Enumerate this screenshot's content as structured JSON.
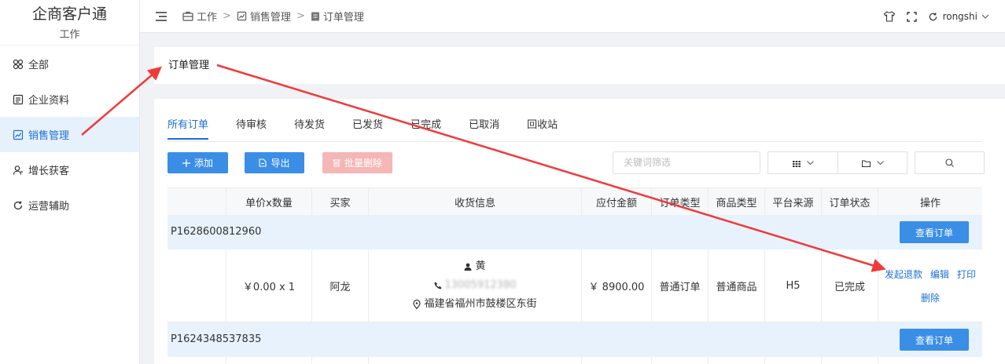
{
  "sidebar": {
    "brand_title": "企商客户通",
    "brand_sub": "工作",
    "items": [
      {
        "label": "全部",
        "icon": "apps-icon"
      },
      {
        "label": "企业资料",
        "icon": "document-icon"
      },
      {
        "label": "销售管理",
        "icon": "sales-icon"
      },
      {
        "label": "增长获客",
        "icon": "user-growth-icon"
      },
      {
        "label": "运营辅助",
        "icon": "refresh-icon"
      }
    ],
    "active_index": 2
  },
  "header": {
    "breadcrumb": [
      "工作",
      "销售管理",
      "订单管理"
    ],
    "separator": ">",
    "username": "rongshi"
  },
  "page_title": "订单管理",
  "tabs": [
    "所有订单",
    "待审核",
    "待发货",
    "已发货",
    "已完成",
    "已取消",
    "回收站"
  ],
  "active_tab": 0,
  "toolbar": {
    "add_label": "添加",
    "export_label": "导出",
    "batch_delete_label": "批量删除",
    "search_placeholder": "关键词筛选"
  },
  "table": {
    "headers": [
      "",
      "单价x数量",
      "买家",
      "收货信息",
      "应付金额",
      "订单类型",
      "商品类型",
      "平台来源",
      "订单状态",
      "操作"
    ],
    "groups": [
      {
        "order_no": "P1628600812960",
        "view_label": "查看订单",
        "row": {
          "price_qty": "￥0.00 x 1",
          "buyer": "阿龙",
          "ship_name": "黄",
          "ship_phone": "13005912380",
          "ship_address": "福建省福州市鼓楼区东街",
          "amount": "￥ 8900.00",
          "order_type": "普通订单",
          "goods_type": "普通商品",
          "platform": "H5",
          "status": "已完成",
          "actions": [
            "发起退款",
            "编辑",
            "打印",
            "删除"
          ]
        }
      },
      {
        "order_no": "P1624348537835",
        "view_label": "查看订单"
      }
    ]
  },
  "colors": {
    "primary": "#3a8ee6",
    "active_text": "#1b6fd6",
    "danger_disabled": "#f5b6b6",
    "annotation_arrow": "#f03a3a"
  }
}
